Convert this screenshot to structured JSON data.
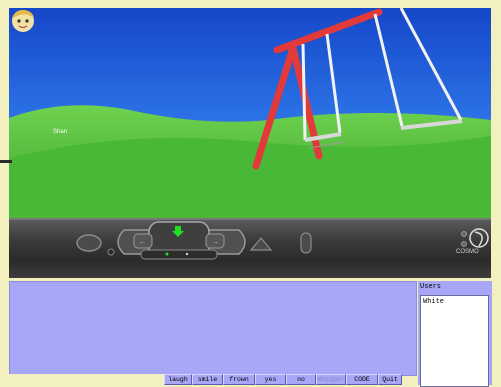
{
  "scene": {
    "avatar_name": "Shan"
  },
  "control_bar": {
    "brand": "COSMO"
  },
  "users_panel": {
    "title": "Users",
    "users": [
      "White"
    ]
  },
  "buttons": [
    {
      "label": "laugh",
      "disabled": false
    },
    {
      "label": "smile",
      "disabled": false
    },
    {
      "label": "frown",
      "disabled": false
    },
    {
      "label": "yes",
      "disabled": false
    },
    {
      "label": "no",
      "disabled": false
    },
    {
      "label": "Whisper",
      "disabled": true
    },
    {
      "label": "CODE",
      "disabled": false
    },
    {
      "label": "Quit",
      "disabled": false
    }
  ],
  "colors": {
    "sky": "#1e58d6",
    "grass": "#4fbf3c",
    "swing_frame": "#e23a3a",
    "chat_bg": "#a7a6f7",
    "page_bg": "#f3f0bf"
  }
}
